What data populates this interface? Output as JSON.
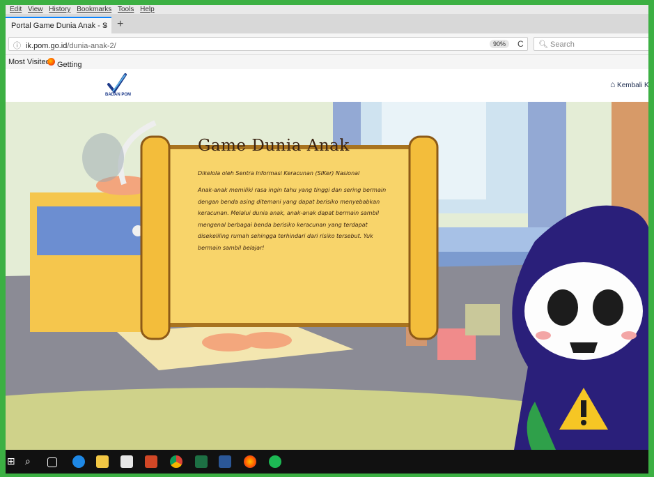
{
  "menu": [
    "Edit",
    "View",
    "History",
    "Bookmarks",
    "Tools",
    "Help"
  ],
  "tab": {
    "title": "Portal Game Dunia Anak - S",
    "close": "×",
    "new": "+"
  },
  "address": {
    "host": "ik.pom.go.id",
    "path": "/dunia-anak-2/",
    "zoom": "90%",
    "reload": "C"
  },
  "search": {
    "placeholder": "Search"
  },
  "bookmarks": {
    "most_visited": "Most Visited",
    "getting_started": "Getting Started"
  },
  "site": {
    "logo_text": "BADAN POM",
    "home_label": "Kembali K"
  },
  "scroll": {
    "title": "Game Dunia Anak",
    "subtitle": "Dikelola oleh Sentra Informasi Keracunan (SIKer) Nasional",
    "body_lines": [
      "Anak-anak memiliki rasa ingin tahu yang tinggi dan sering bermain",
      "dengan benda asing ditemani yang dapat berisiko menyebabkan",
      "keracunan. Melalui dunia anak, anak-anak dapat bermain sambil",
      "mengenal berbagai benda berisiko keracunan yang terdapat",
      "disekeliling rumah sehingga terhindari dari risiko tersebut. Yuk",
      "bermain sambil belajar!"
    ]
  },
  "colors": {
    "frame_green": "#3cb043",
    "scroll": "#f8d46a",
    "character": "#2a1f7a"
  }
}
